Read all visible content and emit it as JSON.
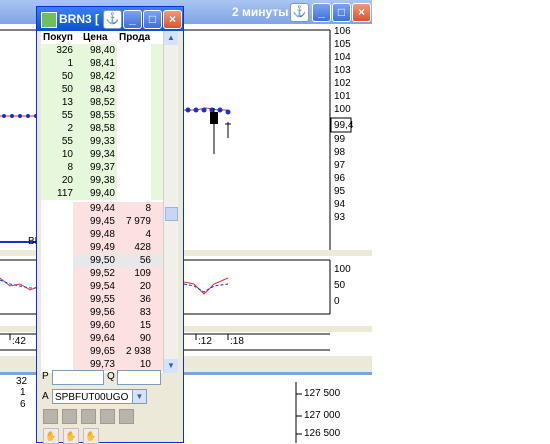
{
  "chart_window": {
    "title": "2 минуты",
    "price_label": "99,4",
    "legend_label": "BR",
    "price_ticks": [
      "106",
      "105",
      "104",
      "103",
      "102",
      "101",
      "100",
      "99",
      "98",
      "97",
      "96",
      "95",
      "94",
      "93"
    ],
    "oscillator_ticks": [
      "100",
      "50",
      "0"
    ],
    "time_ticks": [
      ":42",
      ":12",
      ":18"
    ],
    "volume_ticks": [
      "127 500",
      "127 000",
      "126 500"
    ],
    "bottom_values": [
      "32",
      "1",
      "6"
    ]
  },
  "order_book": {
    "title": "BRN3 [",
    "columns": {
      "buy": "Покуп",
      "price": "Цена",
      "sell": "Прода"
    },
    "bids": [
      {
        "qty": "326",
        "price": "98,40"
      },
      {
        "qty": "1",
        "price": "98,41"
      },
      {
        "qty": "50",
        "price": "98,42"
      },
      {
        "qty": "50",
        "price": "98,43"
      },
      {
        "qty": "13",
        "price": "98,52"
      },
      {
        "qty": "55",
        "price": "98,55"
      },
      {
        "qty": "2",
        "price": "98,58"
      },
      {
        "qty": "55",
        "price": "99,33"
      },
      {
        "qty": "10",
        "price": "99,34"
      },
      {
        "qty": "8",
        "price": "99,37"
      },
      {
        "qty": "20",
        "price": "99,38"
      },
      {
        "qty": "117",
        "price": "99,40"
      }
    ],
    "asks": [
      {
        "price": "99,44",
        "qty": "8"
      },
      {
        "price": "99,45",
        "qty": "7 979"
      },
      {
        "price": "99,48",
        "qty": "4"
      },
      {
        "price": "99,49",
        "qty": "428"
      },
      {
        "price": "99,50",
        "qty": "56"
      },
      {
        "price": "99,52",
        "qty": "109"
      },
      {
        "price": "99,54",
        "qty": "20"
      },
      {
        "price": "99,55",
        "qty": "36"
      },
      {
        "price": "99,56",
        "qty": "83"
      },
      {
        "price": "99,60",
        "qty": "15"
      },
      {
        "price": "99,64",
        "qty": "90"
      },
      {
        "price": "99,65",
        "qty": "2 938"
      },
      {
        "price": "99,73",
        "qty": "10"
      }
    ],
    "price_field_label": "P",
    "qty_field_label": "Q",
    "account_label": "A",
    "account_value": "SPBFUT00UGO",
    "colors": {
      "bid_bg": "#e6f7dc",
      "ask_bg": "#fde0e0",
      "highlight": "#e8e8e8"
    }
  }
}
